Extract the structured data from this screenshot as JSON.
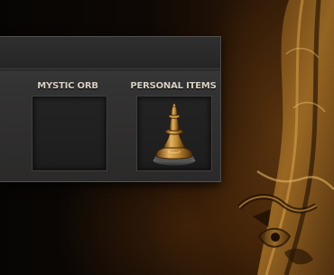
{
  "equipment_panel": {
    "slots": [
      {
        "label": "MYSTIC ORB",
        "item": null
      },
      {
        "label": "PERSONAL ITEMS",
        "item": {
          "icon": "chess-pawn-icon"
        }
      }
    ]
  },
  "colors": {
    "panel": "#333232",
    "slot": "#1f1f1f",
    "label": "#d9d2c4",
    "gold": "#c9902f"
  }
}
